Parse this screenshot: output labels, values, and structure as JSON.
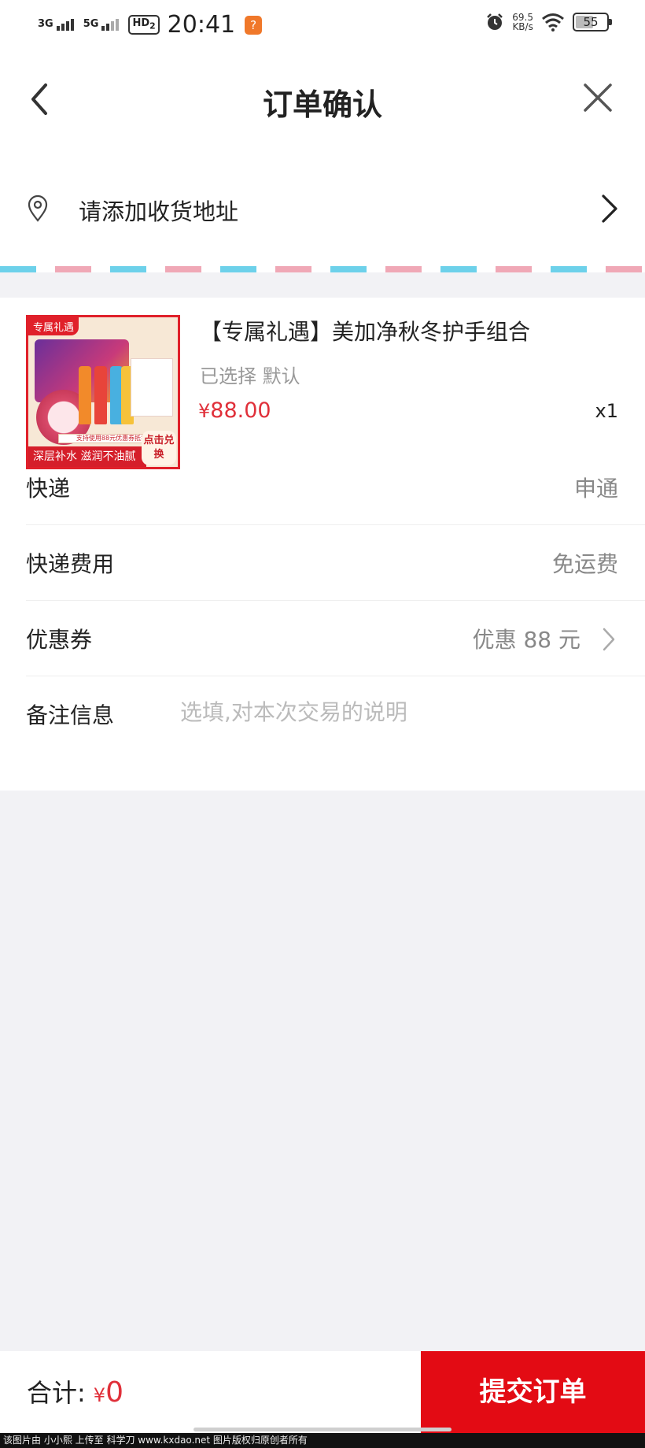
{
  "status_bar": {
    "net1": "3G",
    "net2": "5G",
    "hd": "HD",
    "hd_sub": "2",
    "time": "20:41",
    "app_badge": "?",
    "speed_value": "69.5",
    "speed_unit": "KB/s",
    "battery": "55"
  },
  "header": {
    "title": "订单确认"
  },
  "address": {
    "label": "请添加收货地址"
  },
  "product": {
    "image_tag": "专属礼遇",
    "image_banner": "深层补水 滋润不油腻",
    "image_swap": "点击兑换",
    "image_strip": "支持使用88元优惠券抵扣",
    "name": "【专属礼遇】美加净秋冬护手组合",
    "sku": "已选择 默认",
    "price_symbol": "¥",
    "price_value": "88.00",
    "quantity": "x1"
  },
  "rows": {
    "express_label": "快递",
    "express_value": "申通",
    "fee_label": "快递费用",
    "fee_value": "免运费",
    "coupon_label": "优惠券",
    "coupon_value": "优惠 88 元",
    "note_label": "备注信息",
    "note_placeholder": "选填,对本次交易的说明"
  },
  "footer": {
    "total_label": "合计:",
    "total_symbol": "¥",
    "total_value": "0",
    "submit_label": "提交订单"
  },
  "watermark": "该图片由 小小熙 上传至 科学刀 www.kxdao.net 图片版权归原创者所有",
  "colors": {
    "accent_red": "#e30b14",
    "price_red": "#e0303a",
    "airmail_blue": "#6dd1ea",
    "airmail_pink": "#f0a8b6"
  }
}
